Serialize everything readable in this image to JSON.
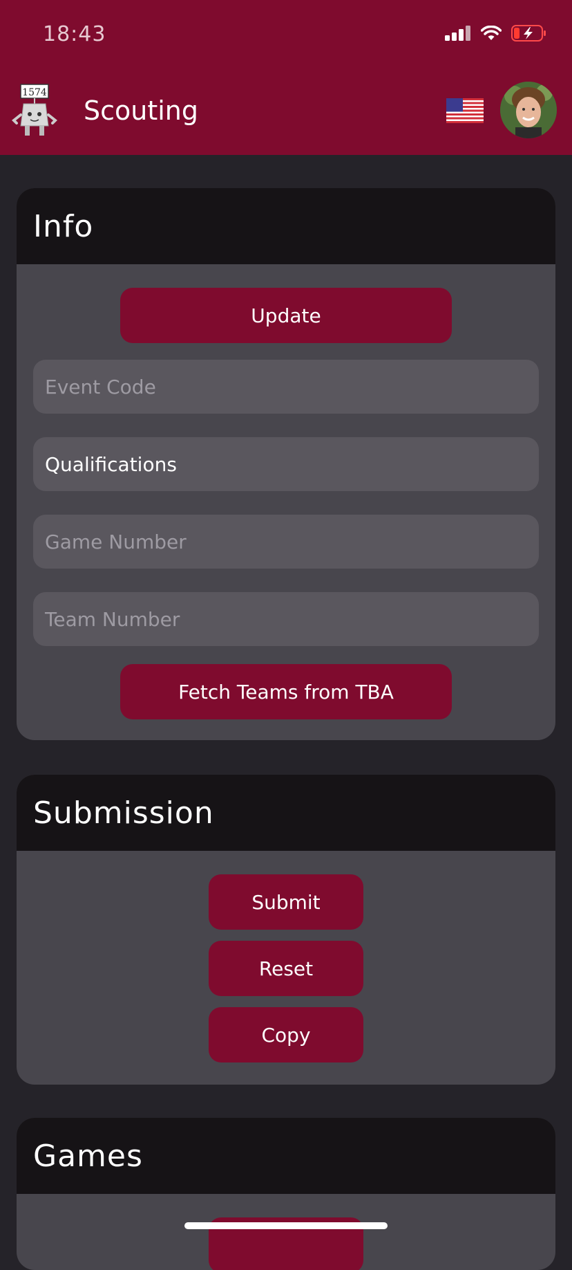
{
  "status_bar": {
    "time": "18:43"
  },
  "header": {
    "title": "Scouting",
    "logo_number": "1574"
  },
  "info": {
    "title": "Info",
    "update_label": "Update",
    "fields": [
      {
        "placeholder": "Event Code",
        "value": ""
      },
      {
        "placeholder": "",
        "value": "Qualifications"
      },
      {
        "placeholder": "Game Number",
        "value": ""
      },
      {
        "placeholder": "Team Number",
        "value": ""
      }
    ],
    "fetch_label": "Fetch Teams from TBA"
  },
  "submission": {
    "title": "Submission",
    "submit_label": "Submit",
    "reset_label": "Reset",
    "copy_label": "Copy"
  },
  "games": {
    "title": "Games"
  },
  "colors": {
    "brand": "#7f0b2e",
    "background": "#252329",
    "card": "#48464d",
    "card_header": "#161316",
    "field": "#5a575e"
  },
  "icons": [
    "signal-icon",
    "wifi-icon",
    "battery-low-charging-icon",
    "team-logo-icon",
    "us-flag-icon",
    "user-avatar"
  ]
}
